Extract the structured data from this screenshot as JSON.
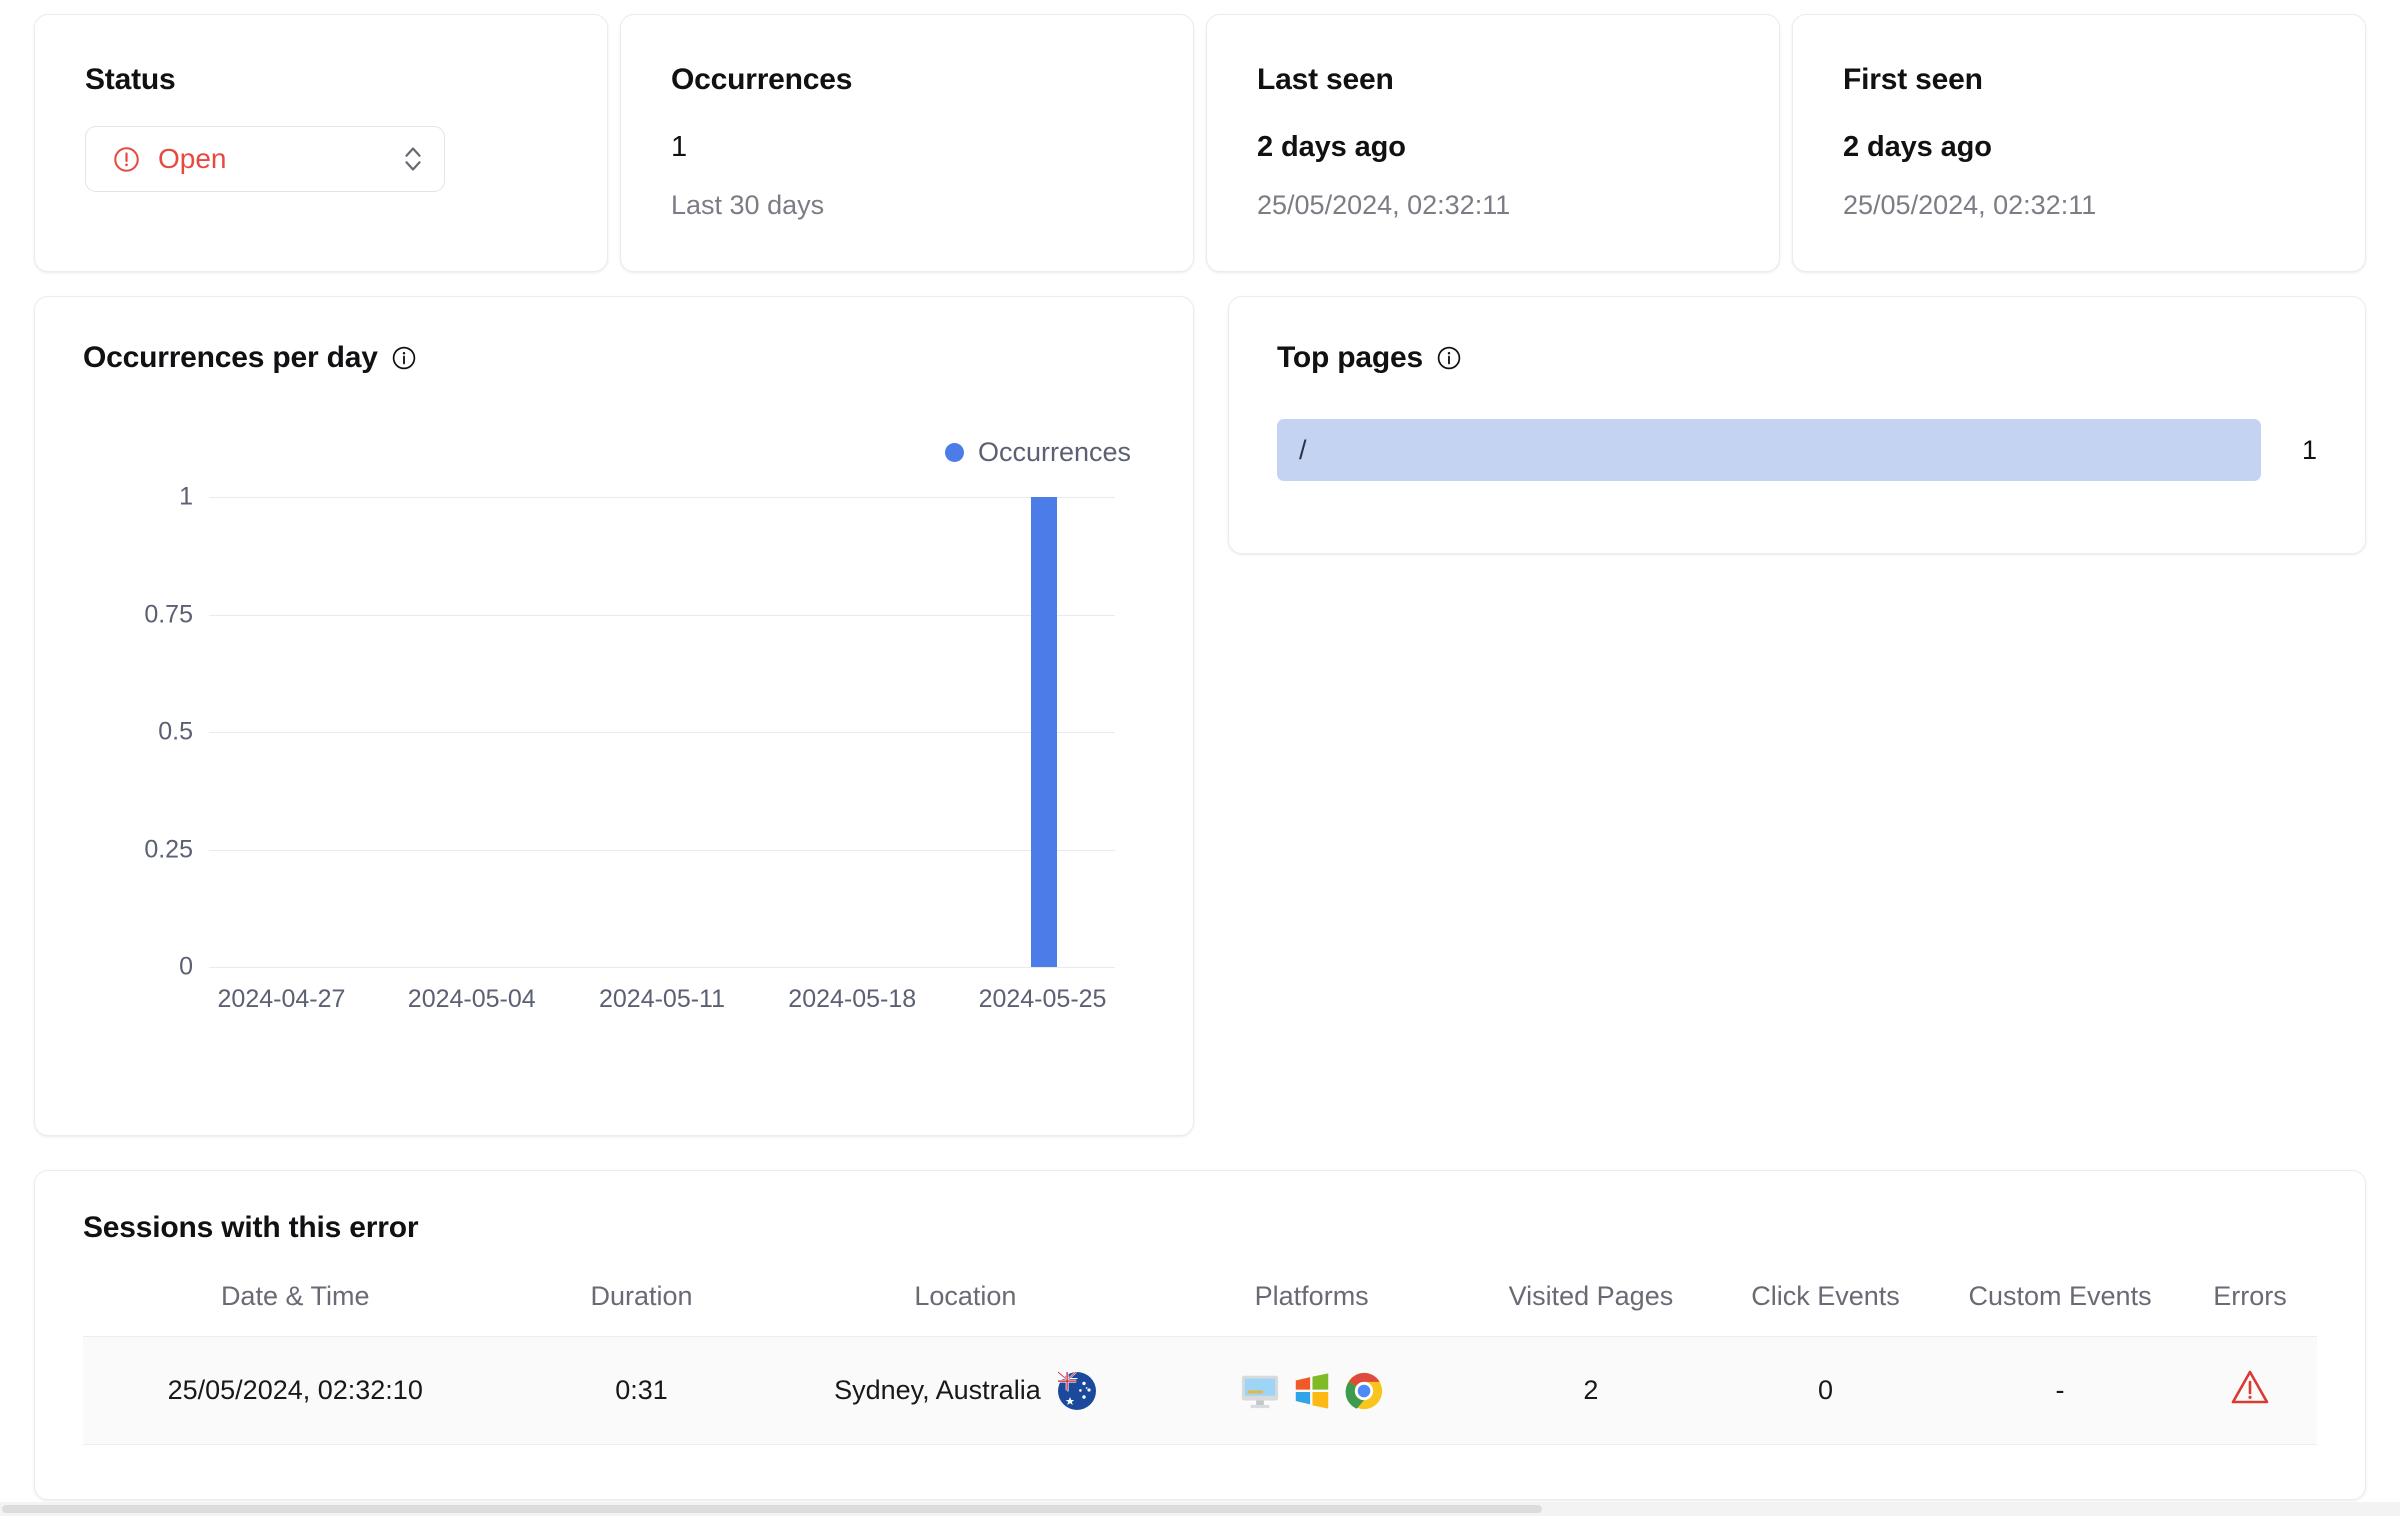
{
  "kpis": [
    {
      "title": "Status",
      "control": "select",
      "value": "Open",
      "value_color": "#e8493f",
      "icon": "alert-circle-icon"
    },
    {
      "title": "Occurrences",
      "value": "1",
      "sub": "Last 30 days"
    },
    {
      "title": "Last seen",
      "value": "2 days ago",
      "sub": "25/05/2024, 02:32:11"
    },
    {
      "title": "First seen",
      "value": "2 days ago",
      "sub": "25/05/2024, 02:32:11"
    }
  ],
  "chart_panel": {
    "title": "Occurrences per day",
    "info_icon": "info-icon"
  },
  "top_pages": {
    "title": "Top pages",
    "info_icon": "info-icon",
    "bar_color": "#c5d3f3",
    "rows": [
      {
        "path": "/",
        "count": "1",
        "pct": 100
      }
    ]
  },
  "sessions": {
    "title": "Sessions with this error",
    "columns": [
      "Date & Time",
      "Duration",
      "Location",
      "Platforms",
      "Visited Pages",
      "Click Events",
      "Custom Events",
      "Errors"
    ],
    "rows": [
      {
        "datetime": "25/05/2024, 02:32:10",
        "duration": "0:31",
        "location": "Sydney, Australia",
        "flag": "australia-flag-icon",
        "platforms": [
          "desktop-icon",
          "windows-icon",
          "chrome-icon"
        ],
        "visited_pages": "2",
        "click_events": "0",
        "custom_events": "-",
        "errors_icon": "warning-triangle-icon"
      }
    ]
  },
  "chart_data": {
    "type": "bar",
    "title": "Occurrences per day",
    "xlabel": "",
    "ylabel": "",
    "legend": [
      {
        "name": "Occurrences",
        "color": "#4c7ce8"
      }
    ],
    "legend_position": "top-right",
    "grid": true,
    "ylim": [
      0,
      1
    ],
    "yticks": [
      "0",
      "0.25",
      "0.5",
      "0.75",
      "1"
    ],
    "ytick_values": [
      0,
      0.25,
      0.5,
      0.75,
      1
    ],
    "xticks": [
      "2024-04-27",
      "2024-05-04",
      "2024-05-11",
      "2024-05-18",
      "2024-05-25"
    ],
    "xtick_positions": [
      0.08,
      0.29,
      0.5,
      0.71,
      0.92
    ],
    "series": [
      {
        "name": "Occurrences",
        "color": "#4c7ce8",
        "points": [
          {
            "x": "2024-05-25",
            "x_frac": 0.922,
            "y": 1
          }
        ]
      }
    ]
  }
}
